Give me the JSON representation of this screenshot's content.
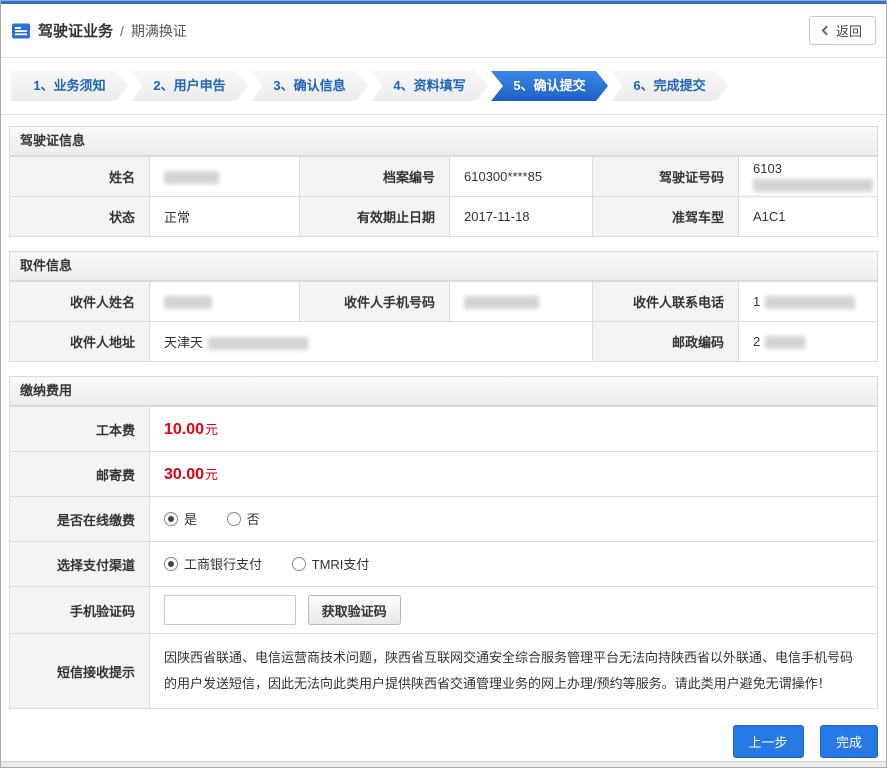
{
  "colors": {
    "accent": "#2b72d7",
    "danger": "#e60012"
  },
  "header": {
    "title_primary": "驾驶证业务",
    "separator": "/",
    "title_secondary": "期满换证",
    "back_label": "返回"
  },
  "steps": [
    {
      "label": "1、业务须知",
      "active": false
    },
    {
      "label": "2、用户申告",
      "active": false
    },
    {
      "label": "3、确认信息",
      "active": false
    },
    {
      "label": "4、资料填写",
      "active": false
    },
    {
      "label": "5、确认提交",
      "active": true
    },
    {
      "label": "6、完成提交",
      "active": false
    }
  ],
  "license": {
    "title": "驾驶证信息",
    "name_label": "姓名",
    "file_label": "档案编号",
    "file_value": "610300****85",
    "number_label": "驾驶证号码",
    "number_prefix": "6103",
    "status_label": "状态",
    "status_value": "正常",
    "expiry_label": "有效期止日期",
    "expiry_value": "2017-11-18",
    "class_label": "准驾车型",
    "class_value": "A1C1"
  },
  "pickup": {
    "title": "取件信息",
    "name_label": "收件人姓名",
    "mobile_label": "收件人手机号码",
    "tel_label": "收件人联系电话",
    "tel_prefix": "1",
    "address_label": "收件人地址",
    "address_prefix": "天津天",
    "zip_label": "邮政编码",
    "zip_prefix": "2"
  },
  "fees": {
    "title": "缴纳费用",
    "production_label": "工本费",
    "production_amount": "10.00",
    "production_unit": "元",
    "postage_label": "邮寄费",
    "postage_amount": "30.00",
    "postage_unit": "元",
    "online_label": "是否在线缴费",
    "online_yes": "是",
    "online_no": "否",
    "channel_label": "选择支付渠道",
    "channel_icbc": "工商银行支付",
    "channel_tmri": "TMRI支付",
    "code_label": "手机验证码",
    "code_button": "获取验证码",
    "notice_label": "短信接收提示",
    "notice_text": "因陕西省联通、电信运营商技术问题，陕西省互联网交通安全综合服务管理平台无法向持陕西省以外联通、电信手机号码的用户发送短信，因此无法向此类用户提供陕西省交通管理业务的网上办理/预约等服务。请此类用户避免无谓操作！"
  },
  "footer": {
    "prev": "上一步",
    "done": "完成"
  }
}
